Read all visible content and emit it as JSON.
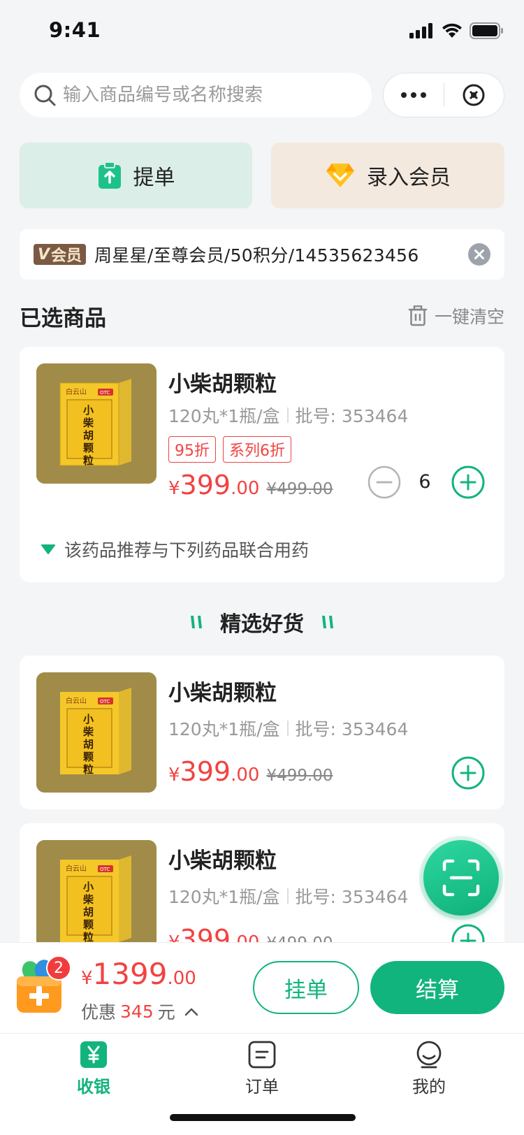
{
  "status": {
    "time": "9:41"
  },
  "search": {
    "placeholder": "输入商品编号或名称搜索"
  },
  "actions": {
    "tidan": "提单",
    "member": "录入会员"
  },
  "member": {
    "tag": "会员",
    "info": "周星星/至尊会员/50积分/14535623456"
  },
  "selected": {
    "title": "已选商品",
    "clear": "一键清空",
    "item": {
      "name": "小柴胡颗粒",
      "spec": "120丸*1瓶/盒",
      "batch": "批号: 353464",
      "tags": [
        "95折",
        "系列6折"
      ],
      "price_yen": "¥",
      "price_int": "399",
      "price_dec": ".00",
      "old_price": "¥499.00",
      "quantity": "6",
      "recommend": "该药品推荐与下列药品联合用药"
    }
  },
  "picks": {
    "title": "精选好货",
    "items": [
      {
        "name": "小柴胡颗粒",
        "spec": "120丸*1瓶/盒",
        "batch": "批号: 353464",
        "price_yen": "¥",
        "price_int": "399",
        "price_dec": ".00",
        "old_price": "¥499.00"
      },
      {
        "name": "小柴胡颗粒",
        "spec": "120丸*1瓶/盒",
        "batch": "批号: 353464",
        "price_yen": "¥",
        "price_int": "399",
        "price_dec": ".00",
        "old_price": "¥499.00"
      }
    ]
  },
  "product_box": {
    "brand": "白云山",
    "otc": "OTC",
    "chars": [
      "小",
      "柴",
      "胡",
      "颗",
      "粒"
    ]
  },
  "checkout": {
    "badge": "2",
    "total_yen": "¥",
    "total_int": "1399",
    "total_dec": ".00",
    "discount_label": "优惠",
    "discount_amount": "345",
    "discount_unit": "元",
    "hold": "挂单",
    "pay": "结算"
  },
  "tabs": [
    {
      "label": "收银",
      "icon": "cashier-icon",
      "active": true
    },
    {
      "label": "订单",
      "icon": "order-icon",
      "active": false
    },
    {
      "label": "我的",
      "icon": "profile-icon",
      "active": false
    }
  ],
  "colors": {
    "primary": "#12b47e",
    "price": "#f24242",
    "vip": "#7a5a44"
  }
}
